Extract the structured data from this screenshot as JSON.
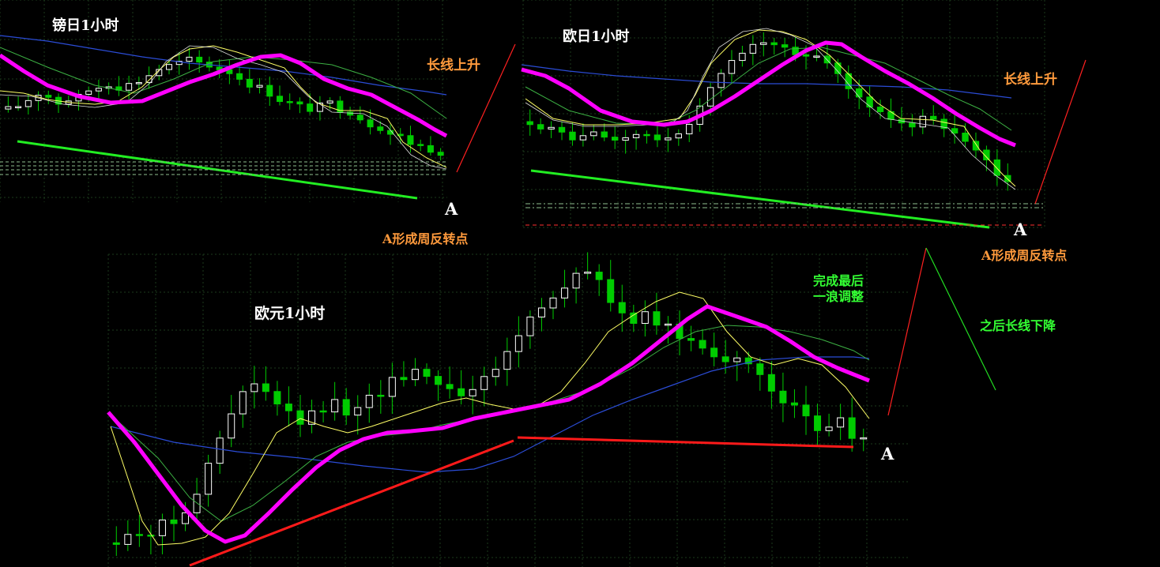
{
  "colors": {
    "background": "#000000",
    "grid": "#1c3a1c",
    "bull_candle": "#ffffff",
    "bear_candle": "#00cc00",
    "ma_thick": "#ff00ff",
    "ma_yellow": "#ffff66",
    "ma_green": "#3cb043",
    "ma_blue": "#2b4cd6",
    "trend_green": "#22ee22",
    "trend_red": "#ff1a1a",
    "label_white": "#ffffff",
    "label_orange": "#ff9a3c",
    "label_green": "#33ff33",
    "hline_dashed": "#8fbf8f"
  },
  "labels": {
    "gbpjpy_title": "镑日1小时",
    "eurjpy_title": "欧日1小时",
    "eurusd_title": "欧元1小时",
    "long_up_1": "长线上升",
    "long_up_2": "长线上升",
    "point_a_1": "A",
    "point_a_2": "A",
    "point_a_3": "A",
    "weekly_reversal_1": "A形成周反转点",
    "weekly_reversal_2": "A形成周反转点",
    "final_wave_1": "完成最后",
    "final_wave_2": "一浪调整",
    "then_long_down": "之后长线下降"
  },
  "chart_data": [
    {
      "type": "candlestick",
      "title": "镑日1小时",
      "series": [
        {
          "values": [
            52,
            54,
            58,
            62,
            60,
            56,
            58,
            60,
            64,
            66,
            68,
            66,
            68,
            70,
            74,
            78,
            80,
            82,
            84,
            82,
            80,
            78,
            76,
            72,
            68,
            66,
            62,
            58,
            56,
            54,
            52,
            54,
            56,
            52,
            50,
            46,
            42,
            40,
            36,
            34,
            30,
            28,
            26,
            24
          ]
        }
      ]
    },
    {
      "type": "candlestick",
      "title": "欧日1小时",
      "series": [
        {
          "values": [
            48,
            46,
            44,
            42,
            40,
            40,
            42,
            40,
            38,
            40,
            42,
            40,
            40,
            38,
            42,
            48,
            56,
            64,
            72,
            80,
            84,
            86,
            88,
            86,
            84,
            82,
            80,
            82,
            78,
            72,
            66,
            60,
            56,
            52,
            50,
            48,
            46,
            50,
            48,
            46,
            44,
            40,
            34,
            28,
            22,
            18
          ]
        }
      ]
    },
    {
      "type": "candlestick",
      "title": "欧元1小时",
      "series": [
        {
          "values": [
            4,
            6,
            8,
            8,
            10,
            12,
            16,
            22,
            30,
            40,
            48,
            56,
            58,
            56,
            52,
            48,
            46,
            48,
            50,
            52,
            50,
            52,
            54,
            56,
            60,
            62,
            64,
            62,
            60,
            58,
            56,
            58,
            60,
            64,
            70,
            76,
            82,
            86,
            90,
            92,
            96,
            98,
            94,
            88,
            84,
            80,
            82,
            80,
            78,
            76,
            74,
            72,
            70,
            68,
            66,
            64,
            62,
            58,
            54,
            50,
            46,
            42,
            44,
            46,
            42,
            40
          ]
        }
      ]
    }
  ]
}
